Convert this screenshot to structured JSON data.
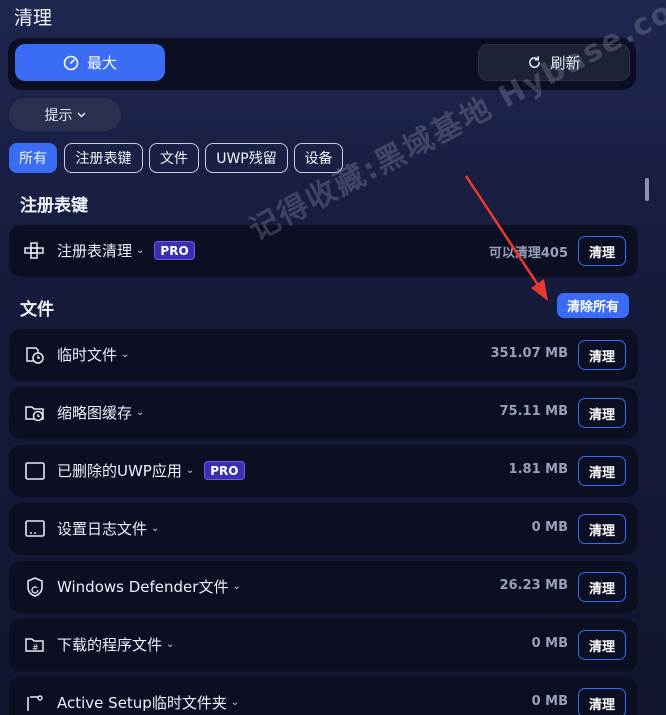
{
  "page_title": "清理",
  "modes": {
    "max_label": "最大",
    "refresh_label": "刷新"
  },
  "hint_label": "提示",
  "filters": [
    "所有",
    "注册表键",
    "文件",
    "UWP残留",
    "设备"
  ],
  "sections": {
    "registry": "注册表键",
    "files": "文件",
    "clear_all": "清除所有"
  },
  "registry_row": {
    "label": "注册表清理",
    "pro": "PRO",
    "info": "可以清理405",
    "action": "清理",
    "icon": "registry-icon"
  },
  "file_rows": [
    {
      "label": "临时文件",
      "size": "351.07 MB",
      "action": "清理",
      "pro": "",
      "icon": "temp-files-icon"
    },
    {
      "label": "缩略图缓存",
      "size": "75.11 MB",
      "action": "清理",
      "pro": "",
      "icon": "thumbnail-cache-icon"
    },
    {
      "label": "已删除的UWP应用",
      "size": "1.81 MB",
      "action": "清理",
      "pro": "PRO",
      "icon": "uwp-app-icon"
    },
    {
      "label": "设置日志文件",
      "size": "0 MB",
      "action": "清理",
      "pro": "",
      "icon": "log-file-icon"
    },
    {
      "label": "Windows Defender文件",
      "size": "26.23 MB",
      "action": "清理",
      "pro": "",
      "icon": "shield-icon"
    },
    {
      "label": "下载的程序文件",
      "size": "0 MB",
      "action": "清理",
      "pro": "",
      "icon": "program-folder-icon"
    },
    {
      "label": "Active Setup临时文件夹",
      "size": "0 MB",
      "action": "清理",
      "pro": "",
      "icon": "setup-folder-icon"
    }
  ],
  "watermark": "记得收藏:黑域基地 Hybase.com",
  "colors": {
    "accent": "#3a6cf6",
    "background": "#161b3c",
    "card": "#0c0f22",
    "pro": "#3b2fb0"
  }
}
